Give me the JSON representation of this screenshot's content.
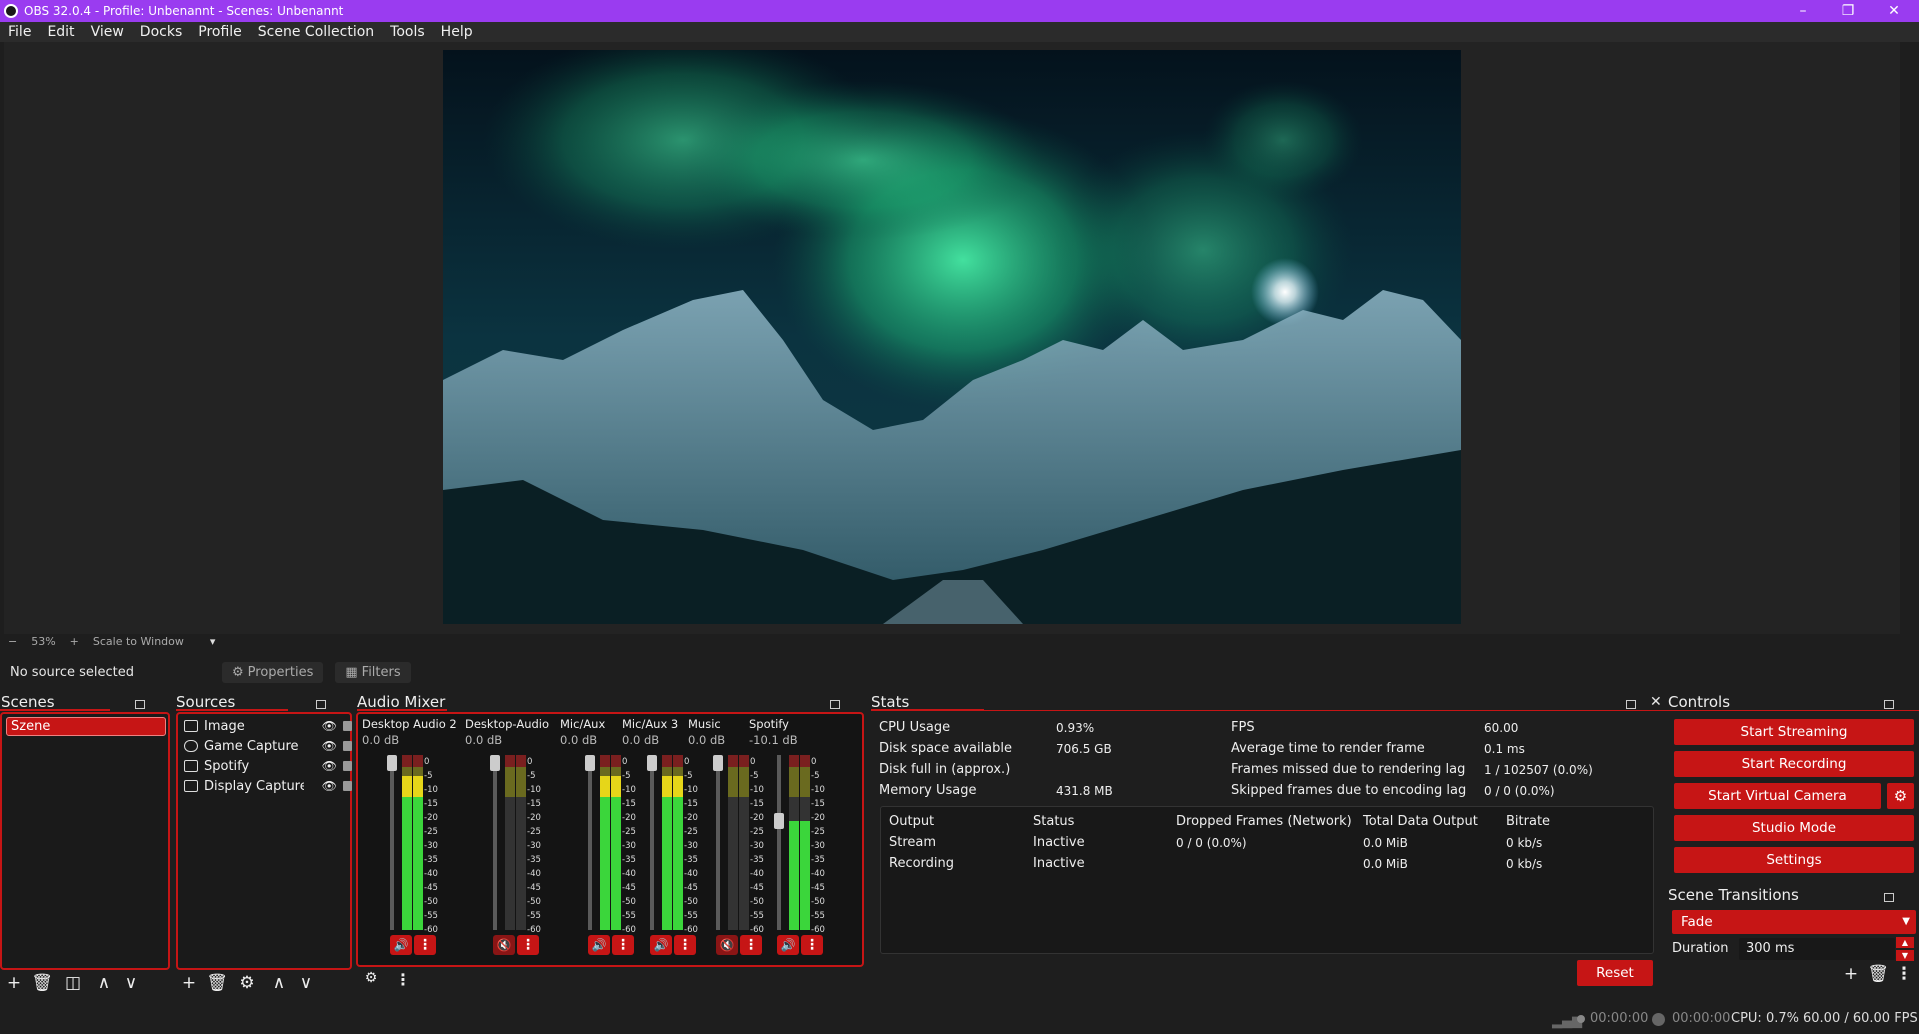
{
  "window": {
    "title": "OBS 32.0.4 - Profile: Unbenannt - Scenes: Unbenannt"
  },
  "menu": [
    "File",
    "Edit",
    "View",
    "Docks",
    "Profile",
    "Scene Collection",
    "Tools",
    "Help"
  ],
  "zoom": {
    "minus": "−",
    "value": "53%",
    "plus": "+",
    "mode": "Scale to Window"
  },
  "sourcebar": {
    "status": "No source selected",
    "properties": "Properties",
    "filters": "Filters"
  },
  "scenes": {
    "title": "Scenes",
    "items": [
      "Szene"
    ]
  },
  "sources": {
    "title": "Sources",
    "items": [
      {
        "name": "Image",
        "icon": "image-icon"
      },
      {
        "name": "Game Capture",
        "icon": "gamepad-icon"
      },
      {
        "name": "Spotify",
        "icon": "window-capture-icon"
      },
      {
        "name": "Display Capture",
        "icon": "monitor-icon"
      }
    ]
  },
  "mixer": {
    "title": "Audio Mixer",
    "channels": [
      {
        "name": "Desktop Audio 2",
        "db": "0.0 dB",
        "level": 0.88,
        "muted": false
      },
      {
        "name": "Desktop-Audio",
        "db": "0.0 dB",
        "level": 0.0,
        "muted": true
      },
      {
        "name": "Mic/Aux",
        "db": "0.0 dB",
        "level": 0.88,
        "muted": false
      },
      {
        "name": "Mic/Aux 3",
        "db": "0.0 dB",
        "level": 0.88,
        "muted": false
      },
      {
        "name": "Music",
        "db": "0.0 dB",
        "level": 0.0,
        "muted": true
      },
      {
        "name": "Spotify",
        "db": "-10.1 dB",
        "level": 0.62,
        "muted": false
      }
    ],
    "scale": [
      "0",
      "-5",
      "-10",
      "-15",
      "-20",
      "-25",
      "-30",
      "-35",
      "-40",
      "-45",
      "-50",
      "-55",
      "-60"
    ]
  },
  "stats": {
    "title": "Stats",
    "left": [
      {
        "label": "CPU Usage",
        "value": "0.93%"
      },
      {
        "label": "Disk space available",
        "value": "706.5 GB"
      },
      {
        "label": "Disk full in (approx.)",
        "value": ""
      },
      {
        "label": "Memory Usage",
        "value": "431.8 MB"
      }
    ],
    "right": [
      {
        "label": "FPS",
        "value": "60.00"
      },
      {
        "label": "Average time to render frame",
        "value": "0.1 ms"
      },
      {
        "label": "Frames missed due to rendering lag",
        "value": "1 / 102507 (0.0%)"
      },
      {
        "label": "Skipped frames due to encoding lag",
        "value": "0 / 0 (0.0%)"
      }
    ],
    "table_headers": [
      "Output",
      "Status",
      "Dropped Frames (Network)",
      "Total Data Output",
      "Bitrate"
    ],
    "rows": [
      [
        "Stream",
        "Inactive",
        "0 / 0 (0.0%)",
        "0.0 MiB",
        "0 kb/s"
      ],
      [
        "Recording",
        "Inactive",
        "",
        "0.0 MiB",
        "0 kb/s"
      ]
    ],
    "reset": "Reset"
  },
  "controls": {
    "title": "Controls",
    "start_streaming": "Start Streaming",
    "start_recording": "Start Recording",
    "start_virtual_camera": "Start Virtual Camera",
    "studio_mode": "Studio Mode",
    "settings": "Settings"
  },
  "transitions": {
    "title": "Scene Transitions",
    "selected": "Fade",
    "duration_label": "Duration",
    "duration_value": "300 ms"
  },
  "status": {
    "stream_time": "00:00:00",
    "record_time": "00:00:00",
    "cpu": "CPU: 0.7%",
    "fps": "60.00 / 60.00 FPS"
  },
  "colors": {
    "accent": "#c61515",
    "titlebar": "#9a3cf0"
  }
}
